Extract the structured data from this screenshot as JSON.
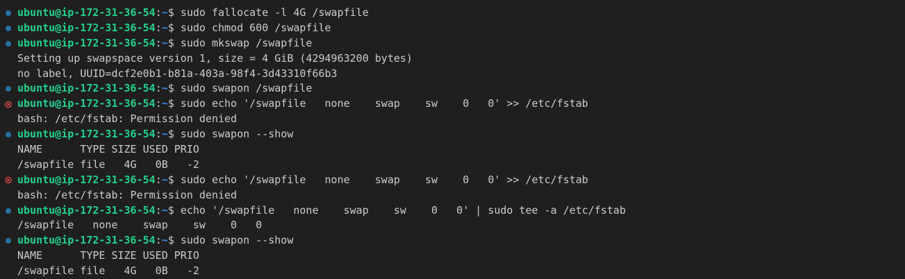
{
  "terminal": {
    "prompt": {
      "user_host": "ubuntu@ip-172-31-36-54",
      "colon": ":",
      "path": "~",
      "sigil": "$ "
    },
    "colors": {
      "background": "#1f1f1f",
      "user_host": "#23d18b",
      "path": "#3b8eea",
      "text": "#cccccc",
      "success_marker": "#2472a4",
      "error_marker": "#f14c4c"
    },
    "lines": [
      {
        "type": "cmd",
        "status": "ok",
        "text": "sudo fallocate -l 4G /swapfile"
      },
      {
        "type": "cmd",
        "status": "ok",
        "text": "sudo chmod 600 /swapfile"
      },
      {
        "type": "cmd",
        "status": "ok",
        "text": "sudo mkswap /swapfile"
      },
      {
        "type": "out",
        "text": "Setting up swapspace version 1, size = 4 GiB (4294963200 bytes)"
      },
      {
        "type": "out",
        "text": "no label, UUID=dcf2e0b1-b81a-403a-98f4-3d43310f66b3"
      },
      {
        "type": "cmd",
        "status": "ok",
        "text": "sudo swapon /swapfile"
      },
      {
        "type": "cmd",
        "status": "error",
        "text": "sudo echo '/swapfile   none    swap    sw    0   0' >> /etc/fstab"
      },
      {
        "type": "out",
        "text": "bash: /etc/fstab: Permission denied"
      },
      {
        "type": "cmd",
        "status": "ok",
        "text": "sudo swapon --show"
      },
      {
        "type": "out",
        "text": "NAME      TYPE SIZE USED PRIO"
      },
      {
        "type": "out",
        "text": "/swapfile file   4G   0B   -2"
      },
      {
        "type": "cmd",
        "status": "error",
        "text": "sudo echo '/swapfile   none    swap    sw    0   0' >> /etc/fstab"
      },
      {
        "type": "out",
        "text": "bash: /etc/fstab: Permission denied"
      },
      {
        "type": "cmd",
        "status": "ok",
        "text": "echo '/swapfile   none    swap    sw    0   0' | sudo tee -a /etc/fstab"
      },
      {
        "type": "out",
        "text": "/swapfile   none    swap    sw    0   0"
      },
      {
        "type": "cmd",
        "status": "ok",
        "text": "sudo swapon --show"
      },
      {
        "type": "out",
        "text": "NAME      TYPE SIZE USED PRIO"
      },
      {
        "type": "out",
        "text": "/swapfile file   4G   0B   -2"
      }
    ]
  }
}
